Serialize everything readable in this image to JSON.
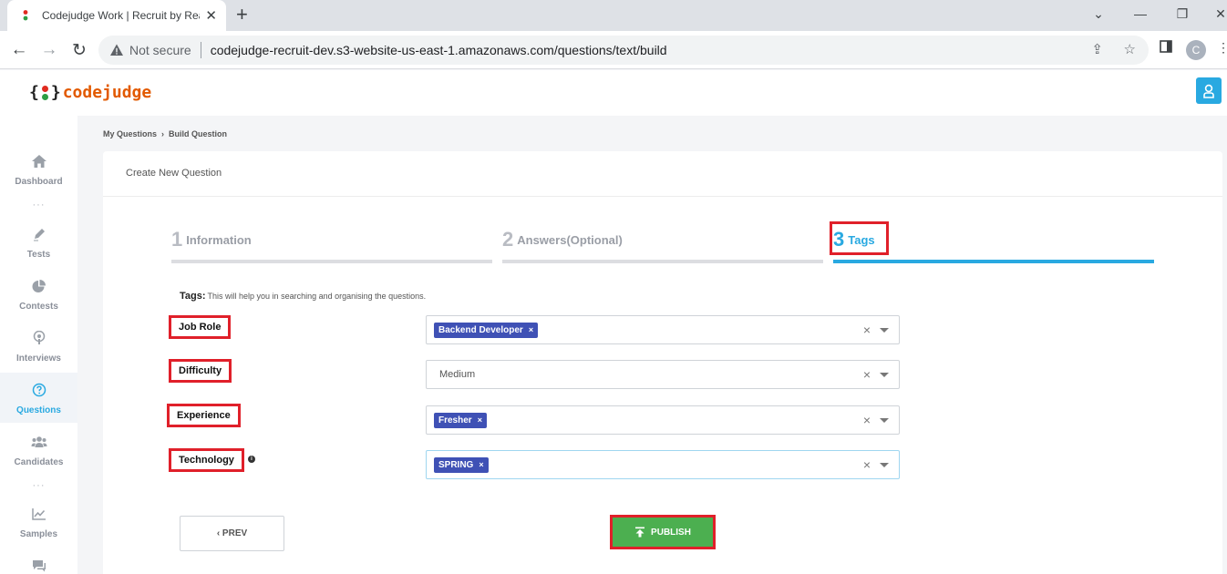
{
  "browser": {
    "tab_title": "Codejudge Work | Recruit by Real",
    "not_secure": "Not secure",
    "url": "codejudge-recruit-dev.s3-website-us-east-1.amazonaws.com/questions/text/build",
    "profile_initial": "C"
  },
  "app": {
    "logo_text": "codejudge",
    "logo_brace_open": "{",
    "logo_brace_close": "}"
  },
  "sidebar": {
    "items": [
      {
        "label": "Dashboard",
        "icon": "home-icon"
      },
      {
        "label": "Tests",
        "icon": "pencil-icon"
      },
      {
        "label": "Contests",
        "icon": "pie-chart-icon"
      },
      {
        "label": "Interviews",
        "icon": "podcast-icon"
      },
      {
        "label": "Questions",
        "icon": "question-circle-icon",
        "active": true
      },
      {
        "label": "Candidates",
        "icon": "users-icon"
      },
      {
        "label": "Samples",
        "icon": "line-chart-icon"
      }
    ],
    "dots": "···"
  },
  "breadcrumb": {
    "items": [
      "My Questions",
      "Build Question"
    ],
    "separator": "›"
  },
  "card": {
    "title": "Create New Question"
  },
  "steps": [
    {
      "number": "1",
      "name": "Information",
      "active": false
    },
    {
      "number": "2",
      "name": "Answers(Optional)",
      "active": false
    },
    {
      "number": "3",
      "name": "Tags",
      "active": true
    }
  ],
  "tags": {
    "label": "Tags:",
    "help": "This will help you in searching and organising the questions.",
    "fields": [
      {
        "label": "Job Role",
        "chip": "Backend Developer"
      },
      {
        "label": "Difficulty",
        "value": "Medium"
      },
      {
        "label": "Experience",
        "chip": "Fresher"
      },
      {
        "label": "Technology",
        "chip": "SPRING"
      }
    ],
    "chip_remove": "×",
    "clear": "×"
  },
  "actions": {
    "prev_label": "‹ PREV",
    "publish_label": "PUBLISH"
  },
  "colors": {
    "accent": "#29a9e1",
    "chip": "#3f51b5",
    "publish": "#4caf50",
    "highlight": "#e0202a",
    "logo": "#e25a00"
  }
}
